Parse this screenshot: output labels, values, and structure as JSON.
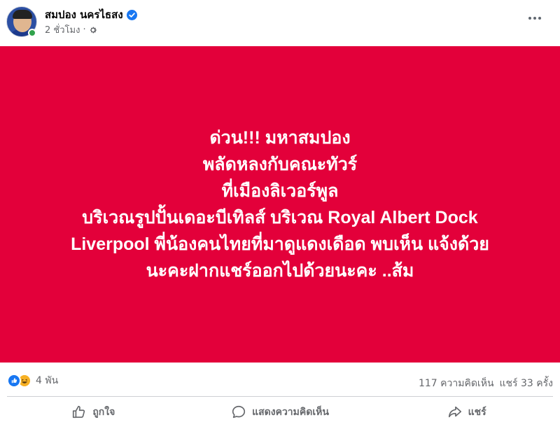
{
  "post": {
    "author": "สมปอง นครไธสง",
    "time": "2 ชั่วโมง",
    "separator": "·",
    "lines": [
      "ด่วน!!! มหาสมปอง",
      "พลัดหลงกับคณะทัวร์",
      "ที่เมืองลิเวอร์พูล",
      "บริเวณรูปปั้นเดอะบีเทิลส์ บริเวณ Royal Albert Dock",
      "Liverpool พี่น้องคนไทยที่มาดูแดงเดือด พบเห็น แจ้งด้วย",
      "นะคะฝากแชร์ออกไปด้วยนะคะ ..ส้ม"
    ],
    "background_color": "#e3003a"
  },
  "reactions": {
    "count": "4 พัน",
    "icons": [
      "like-icon",
      "haha-icon"
    ]
  },
  "counts": {
    "comments": "117 ความคิดเห็น",
    "shares": "แชร์ 33 ครั้ง"
  },
  "actions": {
    "like": "ถูกใจ",
    "comment": "แสดงความคิดเห็น",
    "share": "แชร์"
  }
}
